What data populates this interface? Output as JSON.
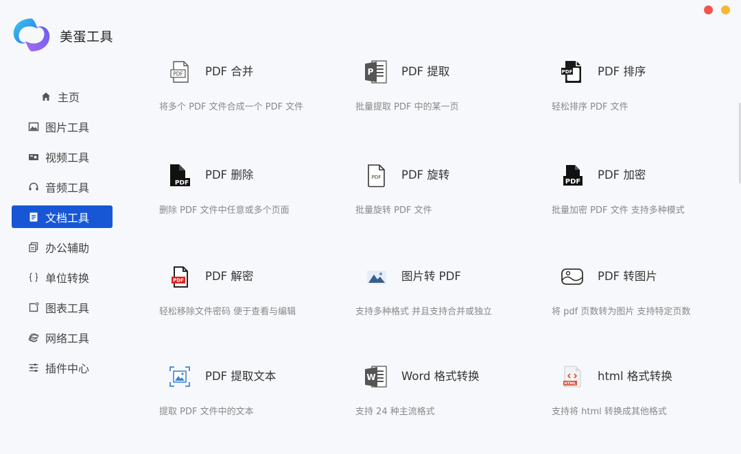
{
  "app": {
    "name": "美蛋工具"
  },
  "sidebar": {
    "items": [
      {
        "label": "主页",
        "icon": "home-icon"
      },
      {
        "label": "图片工具",
        "icon": "image-icon"
      },
      {
        "label": "视频工具",
        "icon": "video-icon"
      },
      {
        "label": "音频工具",
        "icon": "headphone-icon"
      },
      {
        "label": "文档工具",
        "icon": "document-icon",
        "active": true
      },
      {
        "label": "办公辅助",
        "icon": "copy-icon"
      },
      {
        "label": "单位转换",
        "icon": "braces-icon"
      },
      {
        "label": "图表工具",
        "icon": "chart-icon"
      },
      {
        "label": "网络工具",
        "icon": "browser-icon"
      },
      {
        "label": "插件中心",
        "icon": "sliders-icon"
      }
    ]
  },
  "tools": [
    {
      "title": "PDF 合并",
      "desc": "将多个 PDF 文件合成一个 PDF 文件",
      "icon": "pdf-merge-icon"
    },
    {
      "title": "PDF 提取",
      "desc": "批量提取 PDF 中的某一页",
      "icon": "pdf-extract-icon"
    },
    {
      "title": "PDF 排序",
      "desc": "轻松排序 PDF 文件",
      "icon": "pdf-sort-icon"
    },
    {
      "title": "PDF 删除",
      "desc": "删除 PDF 文件中任意或多个页面",
      "icon": "pdf-delete-icon"
    },
    {
      "title": "PDF 旋转",
      "desc": "批量旋转 PDF 文件",
      "icon": "pdf-rotate-icon"
    },
    {
      "title": "PDF 加密",
      "desc": "批量加密 PDF 文件 支持多种模式",
      "icon": "pdf-encrypt-icon"
    },
    {
      "title": "PDF 解密",
      "desc": "轻松移除文件密码 便于查看与编辑",
      "icon": "pdf-decrypt-icon"
    },
    {
      "title": "图片转 PDF",
      "desc": "支持多种格式 并且支持合并或独立",
      "icon": "image-to-pdf-icon"
    },
    {
      "title": "PDF 转图片",
      "desc": "将 pdf 页数转为图片 支持特定页数",
      "icon": "pdf-to-image-icon"
    },
    {
      "title": "PDF 提取文本",
      "desc": "提取 PDF 文件中的文本",
      "icon": "pdf-text-extract-icon"
    },
    {
      "title": "Word 格式转换",
      "desc": "支持 24 种主流格式",
      "icon": "word-icon"
    },
    {
      "title": "html 格式转换",
      "desc": "支持将 html 转换成其他格式",
      "icon": "html-icon"
    }
  ],
  "colors": {
    "accent": "#1757d6",
    "close": "#f0564b",
    "minimize": "#f5b82e",
    "background": "#f7f8fb"
  }
}
